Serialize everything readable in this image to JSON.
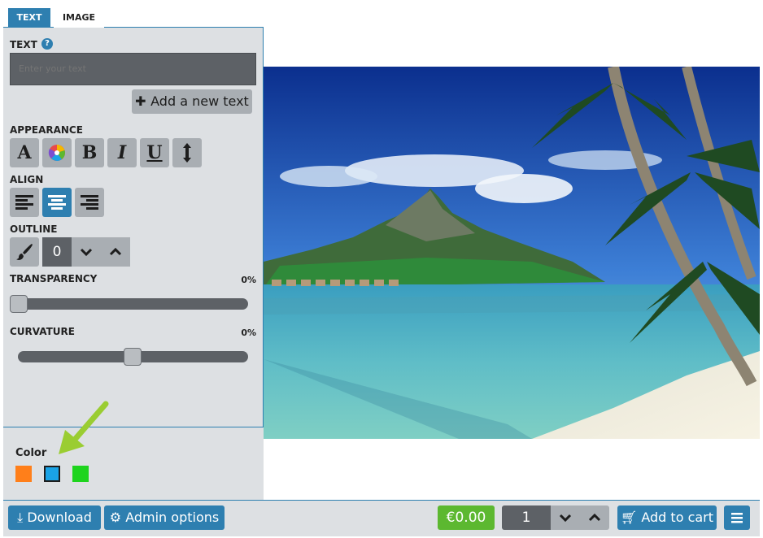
{
  "tabs": {
    "text": "TEXT",
    "image": "IMAGE"
  },
  "text_section": {
    "label": "TEXT",
    "help_icon": "?",
    "placeholder": "Enter your text",
    "add_button": "Add a new text"
  },
  "appearance": {
    "label": "APPEARANCE",
    "buttons": [
      {
        "name": "font-icon",
        "glyph": "A"
      },
      {
        "name": "color-wheel-icon",
        "glyph": ""
      },
      {
        "name": "bold-icon",
        "glyph": "B"
      },
      {
        "name": "italic-icon",
        "glyph": "I"
      },
      {
        "name": "underline-icon",
        "glyph": "U"
      },
      {
        "name": "line-height-icon",
        "glyph": ""
      }
    ]
  },
  "align": {
    "label": "ALIGN",
    "options": [
      "left",
      "center",
      "right"
    ],
    "selected": "center"
  },
  "outline": {
    "label": "OUTLINE",
    "value": "0"
  },
  "transparency": {
    "label": "TRANSPARENCY",
    "value_text": "0%",
    "value": 0
  },
  "curvature": {
    "label": "CURVATURE",
    "value_text": "0%",
    "value": 0.5
  },
  "color_panel": {
    "label": "Color",
    "swatches": [
      "#ff7f1a",
      "#1aa3e6",
      "#1ed41e"
    ],
    "selected_index": 1,
    "arrow_color": "#9acd32"
  },
  "bottom_bar": {
    "download": "Download",
    "admin": "Admin options",
    "price": "€0.00",
    "quantity": "1",
    "add_to_cart": "Add to cart"
  },
  "colors": {
    "accent": "#2e7fb0",
    "price_green": "#5cb830",
    "panel_bg": "#dde0e3",
    "button_gray": "#a9aeb3",
    "dark_field": "#5d6166"
  }
}
